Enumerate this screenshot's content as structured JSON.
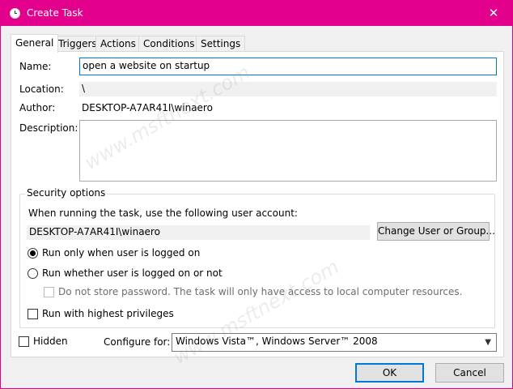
{
  "window": {
    "title": "Create Task",
    "close_glyph": "✕"
  },
  "tabs": [
    {
      "label": "General"
    },
    {
      "label": "Triggers"
    },
    {
      "label": "Actions"
    },
    {
      "label": "Conditions"
    },
    {
      "label": "Settings"
    }
  ],
  "general": {
    "name_label": "Name:",
    "name_value": "open a website on startup",
    "location_label": "Location:",
    "location_value": "\\",
    "author_label": "Author:",
    "author_value": "DESKTOP-A7AR41I\\winaero",
    "description_label": "Description:",
    "description_value": ""
  },
  "security": {
    "legend": "Security options",
    "account_prompt": "When running the task, use the following user account:",
    "account_value": "DESKTOP-A7AR41I\\winaero",
    "change_button": "Change User or Group...",
    "radio_logged_on": "Run only when user is logged on",
    "radio_any": "Run whether user is logged on or not",
    "no_store_password": "Do not store password.  The task will only have access to local computer resources.",
    "highest_privileges": "Run with highest privileges"
  },
  "footer": {
    "hidden_label": "Hidden",
    "configure_label": "Configure for:",
    "configure_value": "Windows Vista™, Windows Server™ 2008",
    "ok_button": "OK",
    "cancel_button": "Cancel"
  },
  "watermark": "www.msftnext.com",
  "colors": {
    "titlebar": "#e3008c",
    "focus": "#0078d7"
  }
}
